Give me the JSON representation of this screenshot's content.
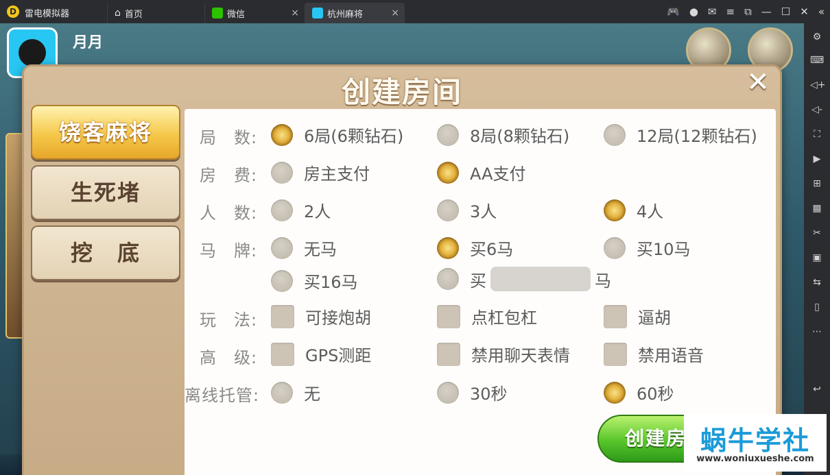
{
  "window": {
    "app_name": "雷电模拟器",
    "tabs": [
      {
        "label": "首页"
      },
      {
        "label": "微信"
      },
      {
        "label": "杭州麻将"
      }
    ],
    "tab_close": "×"
  },
  "game_bg": {
    "top_text": "月月"
  },
  "dialog": {
    "title": "创建房间",
    "close": "✕",
    "side_tabs": [
      {
        "label": "饶客麻将",
        "active": true
      },
      {
        "label": "生死堵",
        "active": false
      },
      {
        "label": "挖　底",
        "active": false
      }
    ],
    "rows": [
      {
        "label": "局　数:",
        "options": [
          {
            "text": "6局(6颗钻石)",
            "selected": true
          },
          {
            "text": "8局(8颗钻石)",
            "selected": false
          },
          {
            "text": "12局(12颗钻石)",
            "selected": false
          }
        ]
      },
      {
        "label": "房　费:",
        "options": [
          {
            "text": "房主支付",
            "selected": false
          },
          {
            "text": "AA支付",
            "selected": true
          }
        ]
      },
      {
        "label": "人　数:",
        "options": [
          {
            "text": "2人",
            "selected": false
          },
          {
            "text": "3人",
            "selected": false
          },
          {
            "text": "4人",
            "selected": true
          }
        ]
      },
      {
        "label": "马　牌:",
        "options": [
          {
            "text": "无马",
            "selected": false
          },
          {
            "text": "买6马",
            "selected": true
          },
          {
            "text": "买10马",
            "selected": false
          },
          {
            "text": "买16马",
            "selected": false
          },
          {
            "text_prefix": "买",
            "text_suffix": "马",
            "selected": false
          }
        ]
      },
      {
        "label": "玩　法:",
        "options": [
          {
            "text": "可接炮胡",
            "checked": false
          },
          {
            "text": "点杠包杠",
            "checked": false
          },
          {
            "text": "逼胡",
            "checked": false
          }
        ]
      },
      {
        "label": "高　级:",
        "options": [
          {
            "text": "GPS测距",
            "checked": false
          },
          {
            "text": "禁用聊天表情",
            "checked": false
          },
          {
            "text": "禁用语音",
            "checked": false
          }
        ]
      },
      {
        "label": "离线托管:",
        "options": [
          {
            "text": "无",
            "selected": false
          },
          {
            "text": "30秒",
            "selected": false
          },
          {
            "text": "60秒",
            "selected": true
          }
        ]
      }
    ],
    "create_button": "创建房间"
  },
  "watermark": {
    "main": "蜗牛学社",
    "sub": "www.woniuxueshe.com"
  },
  "colors": {
    "radio_selected": "#e2b13c",
    "radio_unselected": "#c9c2b6",
    "create_button": "#4cbf25",
    "dialog_frame": "#c7ab86"
  }
}
